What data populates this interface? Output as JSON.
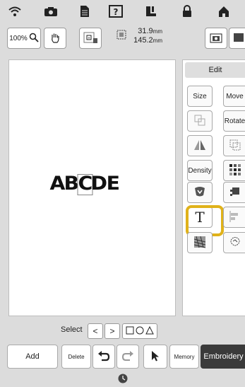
{
  "toolbar": {
    "zoom_label": "100%",
    "size_width": "31.9",
    "size_height": "145.2",
    "size_unit": "mm"
  },
  "pattern": {
    "letters": [
      "A",
      "B",
      "C",
      "D",
      "E"
    ]
  },
  "panel": {
    "edit_label": "Edit",
    "size_label": "Size",
    "move_label": "Move",
    "rotate_label": "Rotate",
    "density_label": "Density",
    "text_label": "T"
  },
  "select_row": {
    "label": "Select",
    "prev_symbol": "<",
    "next_symbol": ">"
  },
  "bottom": {
    "add_label": "Add",
    "delete_label": "Delete",
    "memory_label": "Memory",
    "embroidery_label": "Embroidery"
  },
  "colors": {
    "highlight": "#e0b21a",
    "embroidery_bg": "#3a3a3a"
  }
}
